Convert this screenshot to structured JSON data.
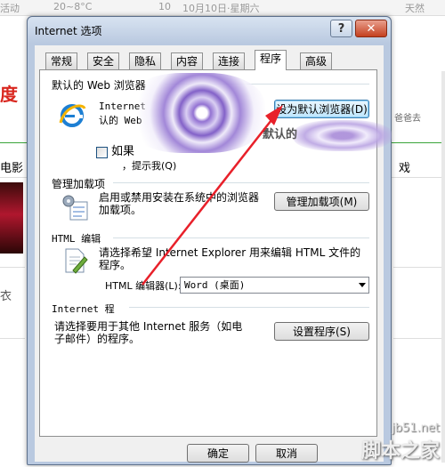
{
  "background": {
    "top_items": [
      "活动",
      "20~8°C",
      "10",
      "10月10日·星期六",
      "天然"
    ],
    "left_char_1": "度",
    "left_char_2": "电影",
    "left_char_3": "衣",
    "right_item_1": "戏",
    "right_item_2": "爸爸去"
  },
  "dialog": {
    "title": "Internet 选项",
    "help_label": "?",
    "close_label": "✕",
    "tabs": [
      "常规",
      "安全",
      "隐私",
      "内容",
      "连接",
      "程序",
      "高级"
    ],
    "active_tab": "程序",
    "default_browser": {
      "group_title": "默认的 Web 浏览器",
      "text_line1": "Internet",
      "text_line2": "认的 Web",
      "button_label": "设为默认浏览器(D)",
      "checkbox_label": "如果",
      "subtext": "，提示我(Q)",
      "overlay_text": "默认的"
    },
    "addons": {
      "group_title": "管理加载项",
      "text": "启用或禁用安装在系统中的浏览器加载项。",
      "button_label": "管理加载项(M)"
    },
    "html_editing": {
      "group_title": "HTML 编辑",
      "text": "请选择希望 Internet Explorer 用来编辑 HTML 文件的程序。",
      "editor_label": "HTML 编辑器(L):",
      "editor_value": "Word (桌面)"
    },
    "internet_programs": {
      "group_title": "Internet 程",
      "text": "请选择要用于其他 Internet 服务（如电子邮件）的程序。",
      "button_label": "设置程序(S)"
    },
    "ok_label": "确定",
    "cancel_label": "取消"
  },
  "watermark": {
    "url": "jb51.net",
    "name": "脚本之家"
  }
}
